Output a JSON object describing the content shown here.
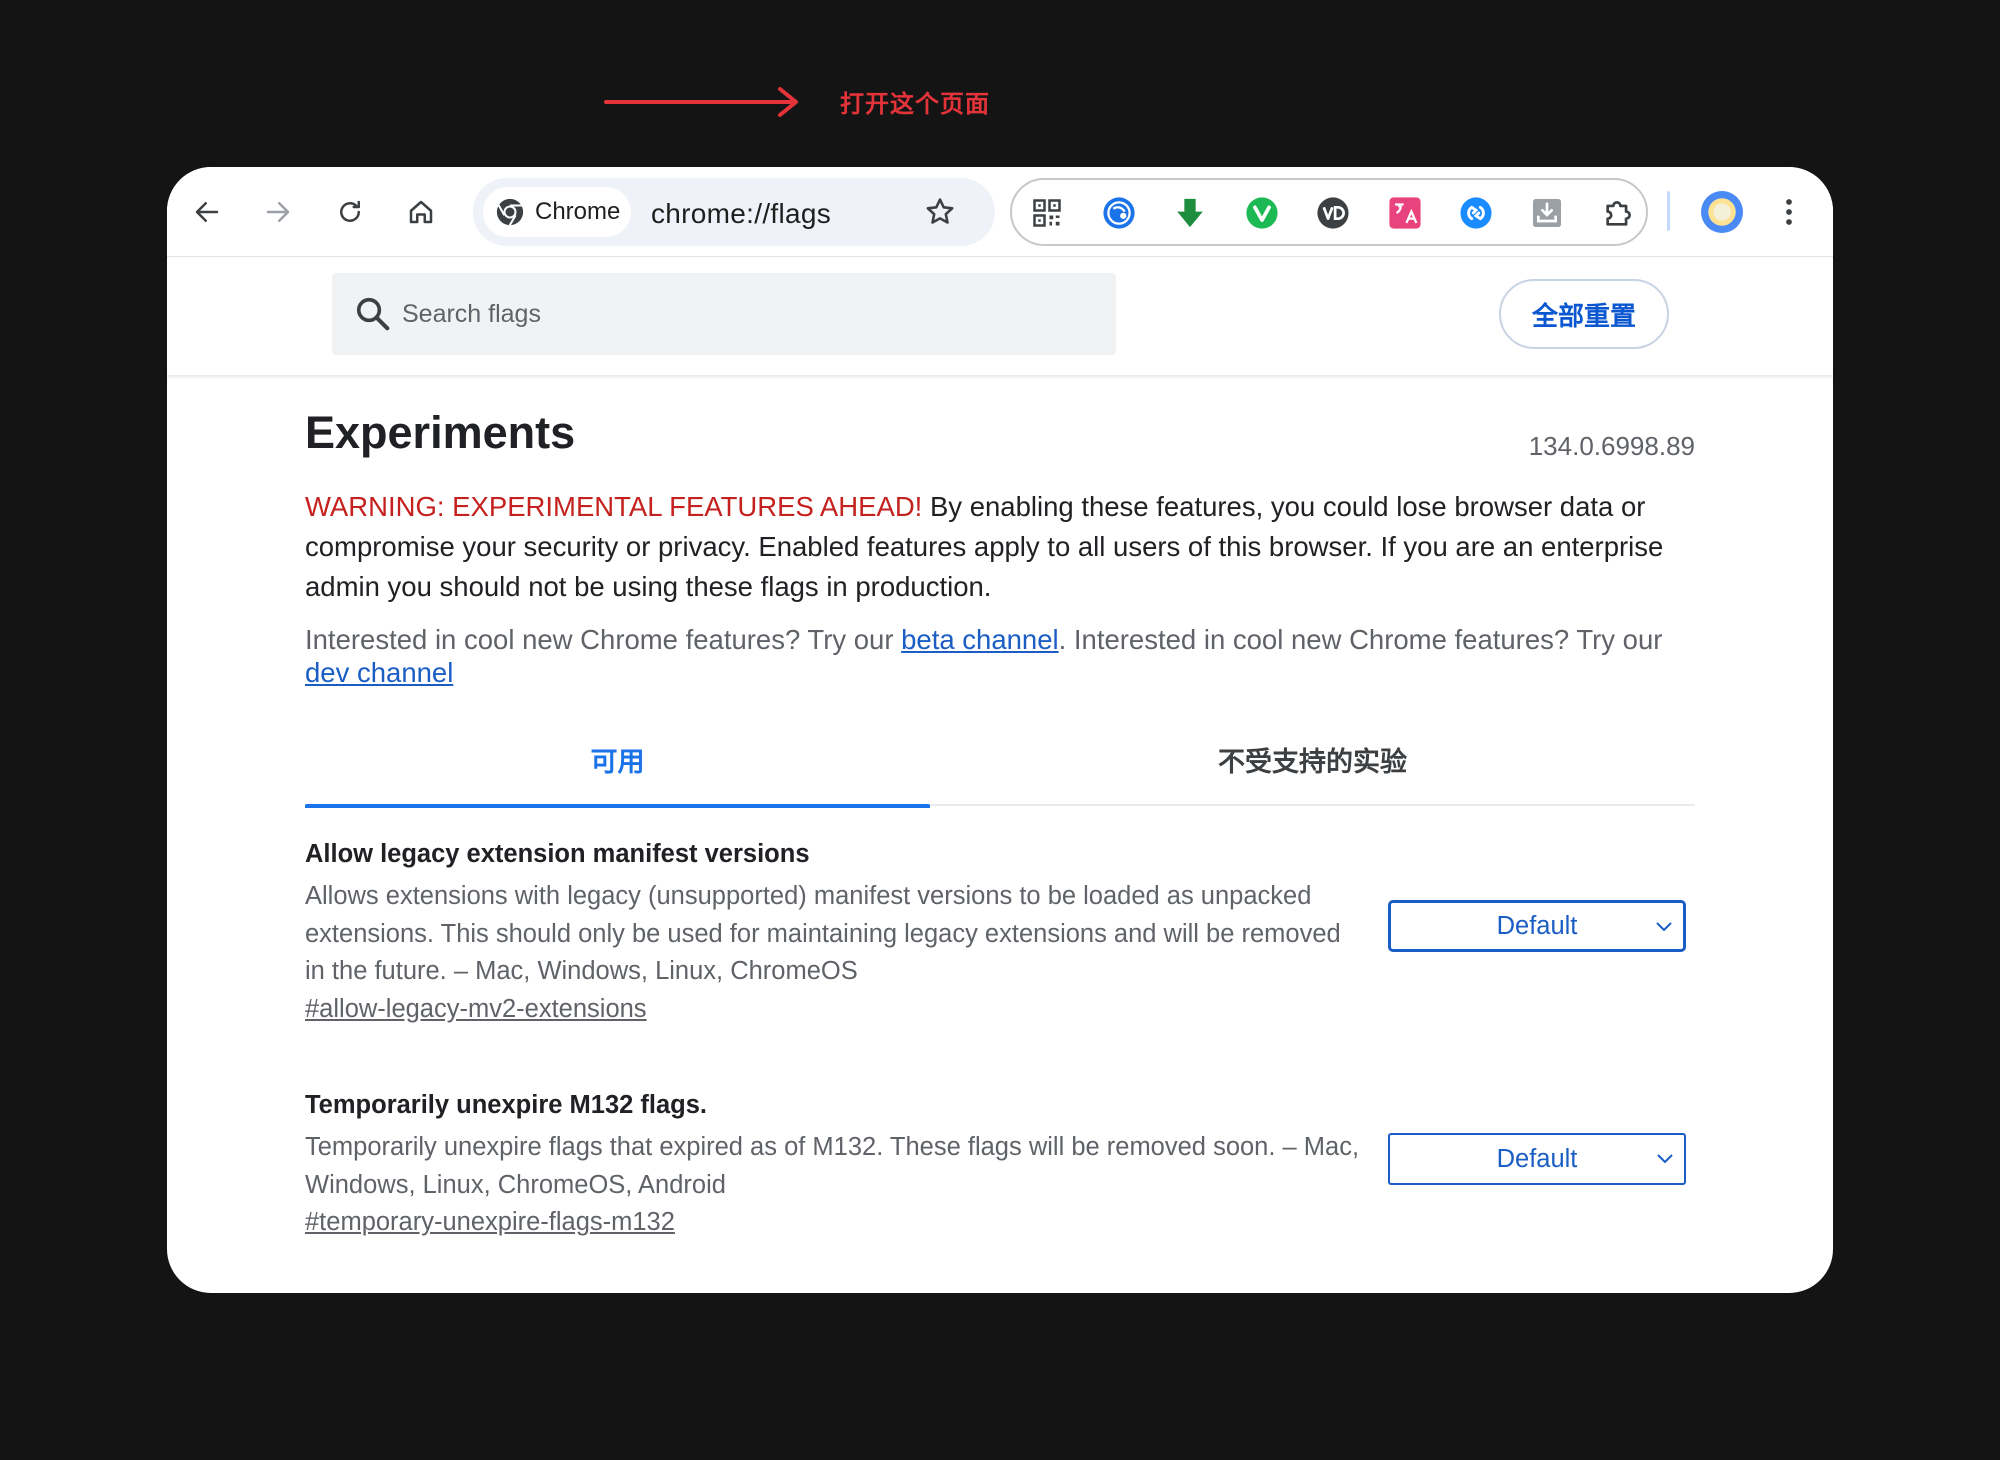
{
  "annotation": {
    "text": "打开这个页面",
    "color": "#e5333a"
  },
  "toolbar": {
    "chip_label": "Chrome",
    "url": "chrome://flags",
    "extensions": [
      "qr-code-icon",
      "globe-extension-icon",
      "download-arrow-icon",
      "green-v-extension-icon",
      "vd-extension-icon",
      "translate-extension-icon",
      "blue-swirl-extension-icon",
      "download-tray-icon",
      "extensions-puzzle-icon"
    ]
  },
  "flags_header": {
    "search_placeholder": "Search flags",
    "reset_label": "全部重置"
  },
  "page": {
    "title": "Experiments",
    "version": "134.0.6998.89",
    "warning_strong": "WARNING: EXPERIMENTAL FEATURES AHEAD!",
    "warning_body": " By enabling these features, you could lose browser data or compromise your security or privacy. Enabled features apply to all users of this browser. If you are an enterprise admin you should not be using these flags in production.",
    "promo_1": "Interested in cool new Chrome features? Try our ",
    "promo_link_1": "beta channel",
    "promo_2": ". Interested in cool new Chrome features? Try our ",
    "promo_link_2": "dev channel"
  },
  "tabs": {
    "available": "可用",
    "unsupported": "不受支持的实验"
  },
  "flags": [
    {
      "name": "Allow legacy extension manifest versions",
      "description": "Allows extensions with legacy (unsupported) manifest versions to be loaded as unpacked extensions. This should only be used for maintaining legacy extensions and will be removed in the future. – Mac, Windows, Linux, ChromeOS",
      "link": "#allow-legacy-mv2-extensions",
      "value": "Default"
    },
    {
      "name": "Temporarily unexpire M132 flags.",
      "description": "Temporarily unexpire flags that expired as of M132. These flags will be removed soon. – Mac, Windows, Linux, ChromeOS, Android",
      "link": "#temporary-unexpire-flags-m132",
      "value": "Default"
    }
  ],
  "colors": {
    "accent": "#1a73e8",
    "warning": "#c5221f",
    "link": "#1a5dc4"
  }
}
